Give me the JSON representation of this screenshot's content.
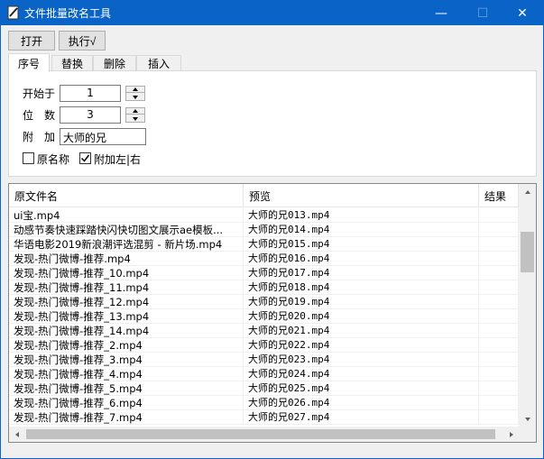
{
  "window": {
    "title": "文件批量改名工具",
    "app_icon": "edit-document-icon",
    "buttons": {
      "minimize": "—",
      "maximize": "☐",
      "close": "✕"
    }
  },
  "toolbar": {
    "open_label": "打开",
    "run_label": "执行√"
  },
  "tabs": [
    {
      "label": "序号",
      "active": true
    },
    {
      "label": "替换",
      "active": false
    },
    {
      "label": "删除",
      "active": false
    },
    {
      "label": "插入",
      "active": false
    }
  ],
  "sequence_tab": {
    "start_label": "开始于",
    "start_value": "1",
    "digits_label": "位　数",
    "digits_value": "3",
    "append_label": "附　加",
    "append_value": "大师的兄",
    "original_name_label": "原名称",
    "original_name_checked": false,
    "append_lr_label": "附加左|右",
    "append_lr_checked": true
  },
  "file_list": {
    "columns": [
      "原文件名",
      "预览",
      "结果"
    ],
    "rows": [
      {
        "original": "ui宝.mp4",
        "preview": "大师的兄013.mp4",
        "result": ""
      },
      {
        "original": "动感节奏快速踩踏快闪快切图文展示ae模板...",
        "preview": "大师的兄014.mp4",
        "result": ""
      },
      {
        "original": "华语电影2019新浪潮评选混剪 - 新片场.mp4",
        "preview": "大师的兄015.mp4",
        "result": ""
      },
      {
        "original": "发现-热门微博-推荐.mp4",
        "preview": "大师的兄016.mp4",
        "result": ""
      },
      {
        "original": "发现-热门微博-推荐_10.mp4",
        "preview": "大师的兄017.mp4",
        "result": ""
      },
      {
        "original": "发现-热门微博-推荐_11.mp4",
        "preview": "大师的兄018.mp4",
        "result": ""
      },
      {
        "original": "发现-热门微博-推荐_12.mp4",
        "preview": "大师的兄019.mp4",
        "result": ""
      },
      {
        "original": "发现-热门微博-推荐_13.mp4",
        "preview": "大师的兄020.mp4",
        "result": ""
      },
      {
        "original": "发现-热门微博-推荐_14.mp4",
        "preview": "大师的兄021.mp4",
        "result": ""
      },
      {
        "original": "发现-热门微博-推荐_2.mp4",
        "preview": "大师的兄022.mp4",
        "result": ""
      },
      {
        "original": "发现-热门微博-推荐_3.mp4",
        "preview": "大师的兄023.mp4",
        "result": ""
      },
      {
        "original": "发现-热门微博-推荐_4.mp4",
        "preview": "大师的兄024.mp4",
        "result": ""
      },
      {
        "original": "发现-热门微博-推荐_5.mp4",
        "preview": "大师的兄025.mp4",
        "result": ""
      },
      {
        "original": "发现-热门微博-推荐_6.mp4",
        "preview": "大师的兄026.mp4",
        "result": ""
      },
      {
        "original": "发现-热门微博-推荐_7.mp4",
        "preview": "大师的兄027.mp4",
        "result": ""
      }
    ]
  }
}
